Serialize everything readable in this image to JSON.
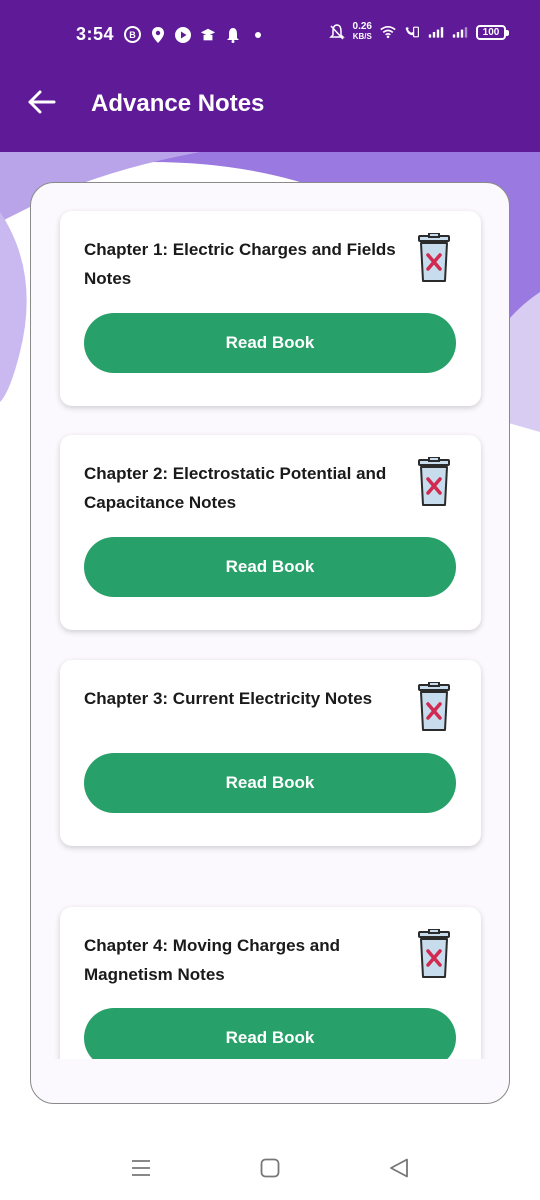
{
  "status": {
    "time": "3:54",
    "net_speed_value": "0.26",
    "net_speed_unit": "KB/S",
    "battery": "100"
  },
  "appbar": {
    "title": "Advance Notes"
  },
  "notes": [
    {
      "title": "Chapter 1: Electric Charges and Fields Notes",
      "button": "Read Book"
    },
    {
      "title": "Chapter 2: Electrostatic Potential and Capacitance Notes",
      "button": "Read Book"
    },
    {
      "title": "Chapter 3: Current Electricity Notes",
      "button": "Read Book"
    },
    {
      "title": "Chapter 4: Moving Charges and Magnetism Notes",
      "button": "Read Book"
    }
  ],
  "colors": {
    "appbar": "#5f1a98",
    "accent_button": "#27a169",
    "trash_fill": "#c7dcec",
    "trash_x": "#d1294f"
  },
  "icons": {
    "back": "arrow-left-icon",
    "delete": "trash-delete-icon",
    "nav_recents": "menu-lines-icon",
    "nav_home": "square-home-icon",
    "nav_back": "triangle-back-icon"
  }
}
